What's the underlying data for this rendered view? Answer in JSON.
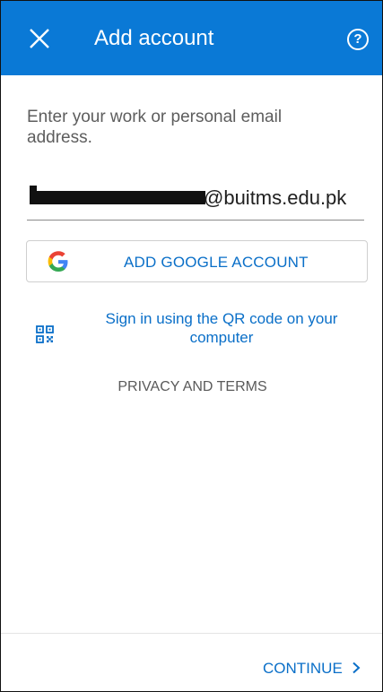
{
  "header": {
    "title": "Add account",
    "help_symbol": "?"
  },
  "form": {
    "prompt": "Enter your work or personal email address.",
    "email_domain": "@buitms.edu.pk"
  },
  "buttons": {
    "google_label": "ADD GOOGLE ACCOUNT",
    "qr_label": "Sign in using the QR code on your computer",
    "privacy_label": "PRIVACY AND TERMS",
    "continue_label": "CONTINUE"
  },
  "icons": {
    "close": "close-icon",
    "help": "help-circle-icon",
    "google": "google-logo-icon",
    "qr": "qr-code-icon",
    "chevron": "chevron-right-icon"
  },
  "colors": {
    "accent": "#0a79d6",
    "link": "#0a6fc8",
    "text_muted": "#5d5d5d"
  }
}
